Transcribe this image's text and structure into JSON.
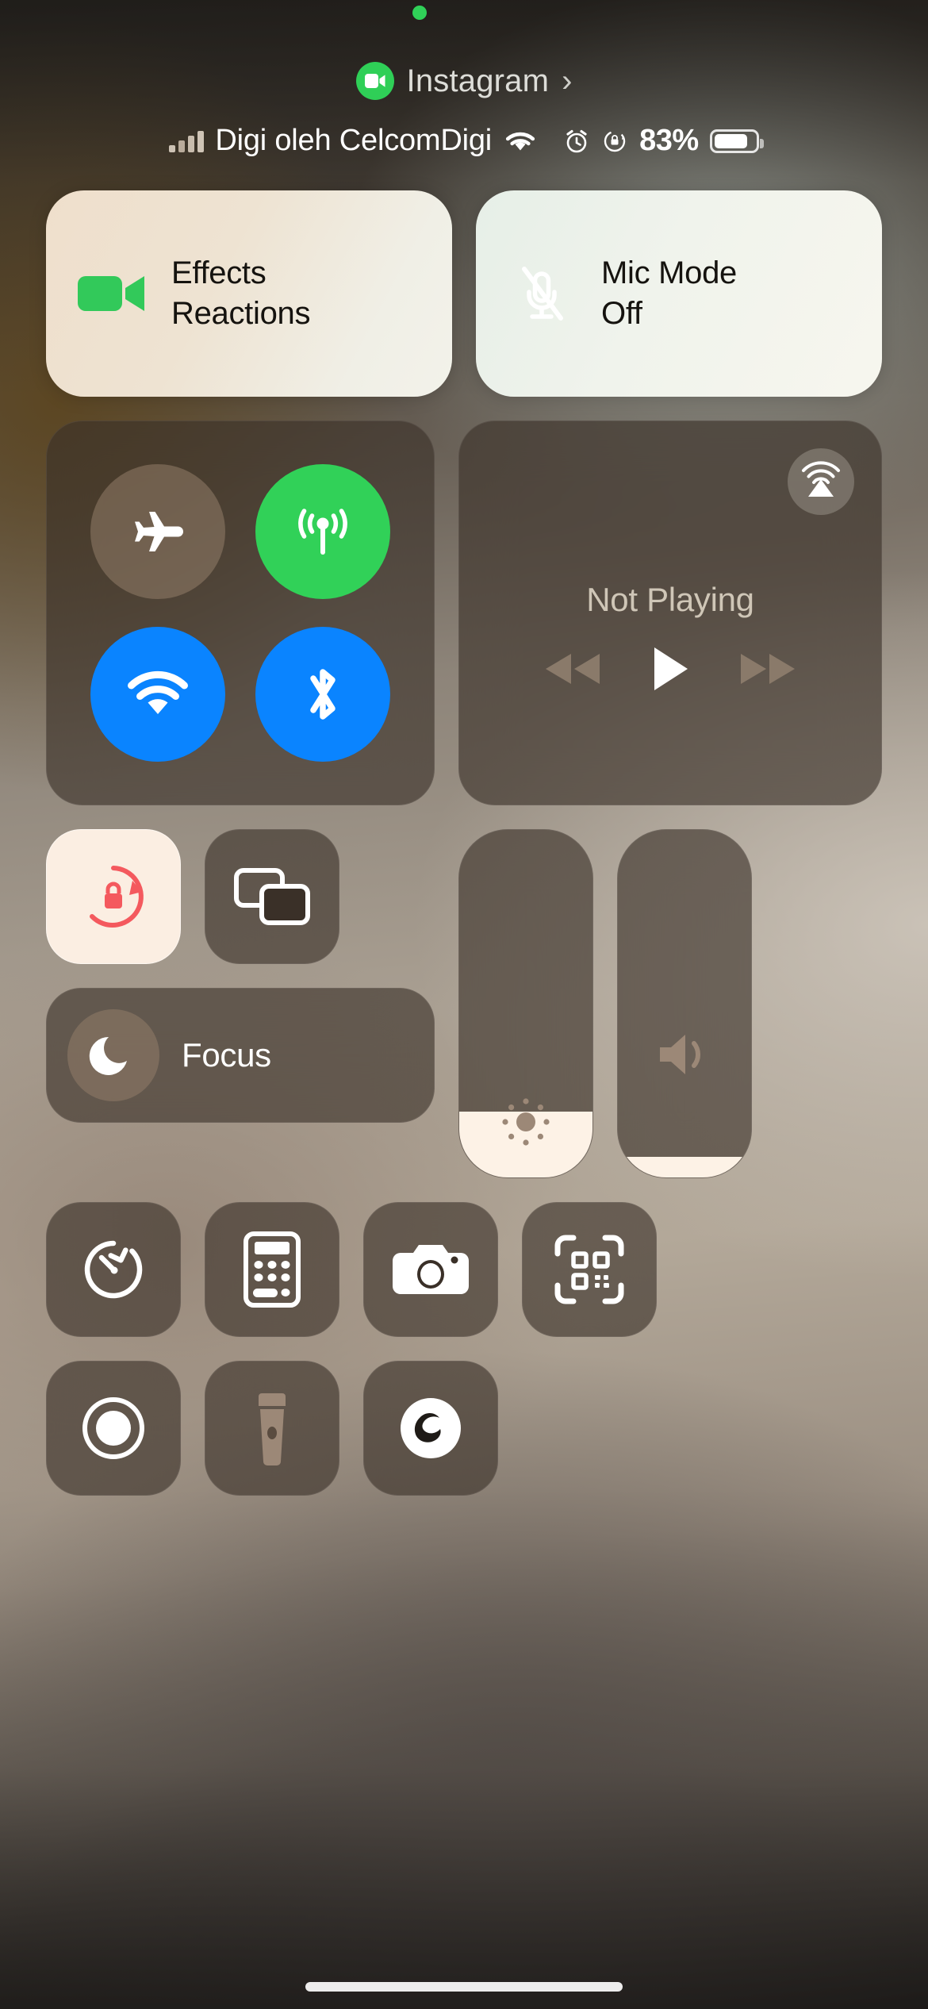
{
  "system": {
    "recording_indicator": "green-dot",
    "home_indicator": "home-indicator"
  },
  "app_pill": {
    "icon": "video-camera-icon",
    "app_name": "Instagram",
    "chevron": "›"
  },
  "status_bar": {
    "signal_icon": "cellular-signal-icon",
    "carrier": "Digi oleh CelcomDigi",
    "wifi_icon": "wifi-icon",
    "alarm_icon": "alarm-clock-icon",
    "rotation_lock_icon": "rotation-lock-icon",
    "battery_percent": "83%",
    "battery_level": 83,
    "battery_icon": "battery-icon"
  },
  "call_cards": [
    {
      "id": "effects",
      "icon": "video-camera-icon",
      "title": "Effects",
      "subtitle": "Reactions",
      "icon_color": "#32c95a"
    },
    {
      "id": "mic-mode",
      "icon": "mic-off-icon",
      "title": "Mic Mode",
      "subtitle": "Off",
      "icon_color": "#ffffff"
    }
  ],
  "connectivity": {
    "label": "connectivity-module",
    "toggles": [
      {
        "id": "airplane-mode",
        "icon": "airplane-icon",
        "state": "off",
        "color": "#96806c"
      },
      {
        "id": "cellular-data",
        "icon": "cellular-tower-icon",
        "state": "on",
        "color": "#31d158"
      },
      {
        "id": "wifi",
        "icon": "wifi-icon",
        "state": "on",
        "color": "#0a84ff"
      },
      {
        "id": "bluetooth",
        "icon": "bluetooth-icon",
        "state": "on",
        "color": "#0a84ff"
      }
    ]
  },
  "media": {
    "airplay_icon": "airplay-audio-icon",
    "status_text": "Not Playing",
    "controls": [
      {
        "id": "rewind",
        "icon": "rewind-icon",
        "state": "dim"
      },
      {
        "id": "play",
        "icon": "play-icon",
        "state": "bright"
      },
      {
        "id": "forward",
        "icon": "forward-icon",
        "state": "dim"
      }
    ]
  },
  "tiles": {
    "rotation_lock": {
      "id": "rotation-lock",
      "icon": "rotation-lock-icon",
      "state": "on",
      "icon_color": "#f4595e"
    },
    "screen_mirror": {
      "id": "screen-mirroring",
      "icon": "screen-mirroring-icon",
      "state": "off",
      "icon_color": "#ffffff"
    },
    "focus": {
      "id": "focus",
      "icon": "moon-icon",
      "label": "Focus",
      "state": "off"
    }
  },
  "sliders": [
    {
      "id": "brightness",
      "icon": "brightness-icon",
      "value": 19,
      "unit": "%"
    },
    {
      "id": "volume",
      "icon": "speaker-icon",
      "value": 6,
      "unit": "%"
    }
  ],
  "shortcuts_row_1": [
    {
      "id": "timer",
      "icon": "timer-icon"
    },
    {
      "id": "calculator",
      "icon": "calculator-icon"
    },
    {
      "id": "camera",
      "icon": "camera-icon"
    },
    {
      "id": "code-scanner",
      "icon": "qr-code-scanner-icon"
    }
  ],
  "shortcuts_row_2": [
    {
      "id": "screen-record",
      "icon": "screen-record-icon"
    },
    {
      "id": "flashlight",
      "icon": "flashlight-icon"
    },
    {
      "id": "shazam",
      "icon": "shazam-icon"
    }
  ],
  "colors": {
    "accent_green": "#31d158",
    "accent_blue": "#0a84ff",
    "accent_red": "#f4595e",
    "tile_bg": "#3a3028",
    "tile_active_bg": "#fbeee2"
  }
}
